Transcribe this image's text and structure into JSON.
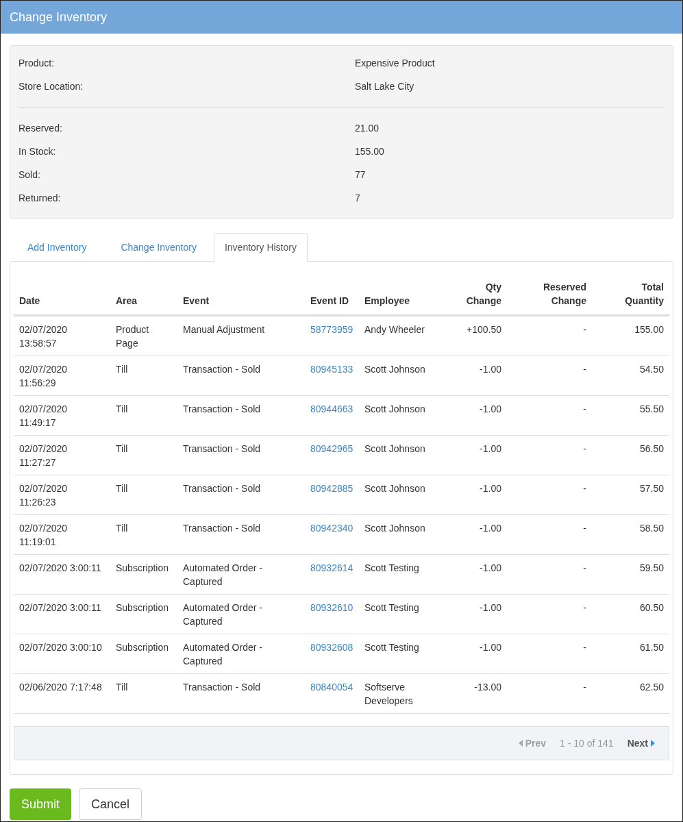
{
  "title": "Change Inventory",
  "summary": {
    "groups": [
      [
        {
          "label": "Product:",
          "value": "Expensive Product"
        },
        {
          "label": "Store Location:",
          "value": "Salt Lake City"
        }
      ],
      [
        {
          "label": "Reserved:",
          "value": "21.00"
        },
        {
          "label": "In Stock:",
          "value": "155.00"
        },
        {
          "label": "Sold:",
          "value": "77"
        },
        {
          "label": "Returned:",
          "value": "7"
        }
      ]
    ]
  },
  "tabs": [
    {
      "label": "Add Inventory",
      "selected": false
    },
    {
      "label": "Change Inventory",
      "selected": false
    },
    {
      "label": "Inventory History",
      "selected": true
    }
  ],
  "table": {
    "columns": [
      "Date",
      "Area",
      "Event",
      "Event ID",
      "Employee",
      "Qty Change",
      "Reserved Change",
      "Total Quantity"
    ],
    "rows": [
      {
        "date": "02/07/2020 13:58:57",
        "area": "Product Page",
        "event": "Manual Adjustment",
        "event_id": "58773959",
        "employee": "Andy Wheeler",
        "qty_change": "+100.50",
        "reserved_change": "-",
        "total_quantity": "155.00"
      },
      {
        "date": "02/07/2020 11:56:29",
        "area": "Till",
        "event": "Transaction - Sold",
        "event_id": "80945133",
        "employee": "Scott Johnson",
        "qty_change": "-1.00",
        "reserved_change": "-",
        "total_quantity": "54.50"
      },
      {
        "date": "02/07/2020 11:49:17",
        "area": "Till",
        "event": "Transaction - Sold",
        "event_id": "80944663",
        "employee": "Scott Johnson",
        "qty_change": "-1.00",
        "reserved_change": "-",
        "total_quantity": "55.50"
      },
      {
        "date": "02/07/2020 11:27:27",
        "area": "Till",
        "event": "Transaction - Sold",
        "event_id": "80942965",
        "employee": "Scott Johnson",
        "qty_change": "-1.00",
        "reserved_change": "-",
        "total_quantity": "56.50"
      },
      {
        "date": "02/07/2020 11:26:23",
        "area": "Till",
        "event": "Transaction - Sold",
        "event_id": "80942885",
        "employee": "Scott Johnson",
        "qty_change": "-1.00",
        "reserved_change": "-",
        "total_quantity": "57.50"
      },
      {
        "date": "02/07/2020 11:19:01",
        "area": "Till",
        "event": "Transaction - Sold",
        "event_id": "80942340",
        "employee": "Scott Johnson",
        "qty_change": "-1.00",
        "reserved_change": "-",
        "total_quantity": "58.50"
      },
      {
        "date": "02/07/2020 3:00:11",
        "area": "Subscription",
        "event": "Automated Order - Captured",
        "event_id": "80932614",
        "employee": "Scott Testing",
        "qty_change": "-1.00",
        "reserved_change": "-",
        "total_quantity": "59.50"
      },
      {
        "date": "02/07/2020 3:00:11",
        "area": "Subscription",
        "event": "Automated Order - Captured",
        "event_id": "80932610",
        "employee": "Scott Testing",
        "qty_change": "-1.00",
        "reserved_change": "-",
        "total_quantity": "60.50"
      },
      {
        "date": "02/07/2020 3:00:10",
        "area": "Subscription",
        "event": "Automated Order - Captured",
        "event_id": "80932608",
        "employee": "Scott Testing",
        "qty_change": "-1.00",
        "reserved_change": "-",
        "total_quantity": "61.50"
      },
      {
        "date": "02/06/2020 7:17:48",
        "area": "Till",
        "event": "Transaction - Sold",
        "event_id": "80840054",
        "employee": "Softserve Developers",
        "qty_change": "-13.00",
        "reserved_change": "-",
        "total_quantity": "62.50"
      }
    ]
  },
  "pagination": {
    "prev": {
      "label": "Prev",
      "disabled": true
    },
    "range": "1 - 10 of 141",
    "next": {
      "label": "Next",
      "disabled": false
    }
  },
  "buttons": [
    {
      "label": "Submit",
      "kind": "primary"
    },
    {
      "label": "Cancel",
      "kind": "secondary"
    }
  ]
}
